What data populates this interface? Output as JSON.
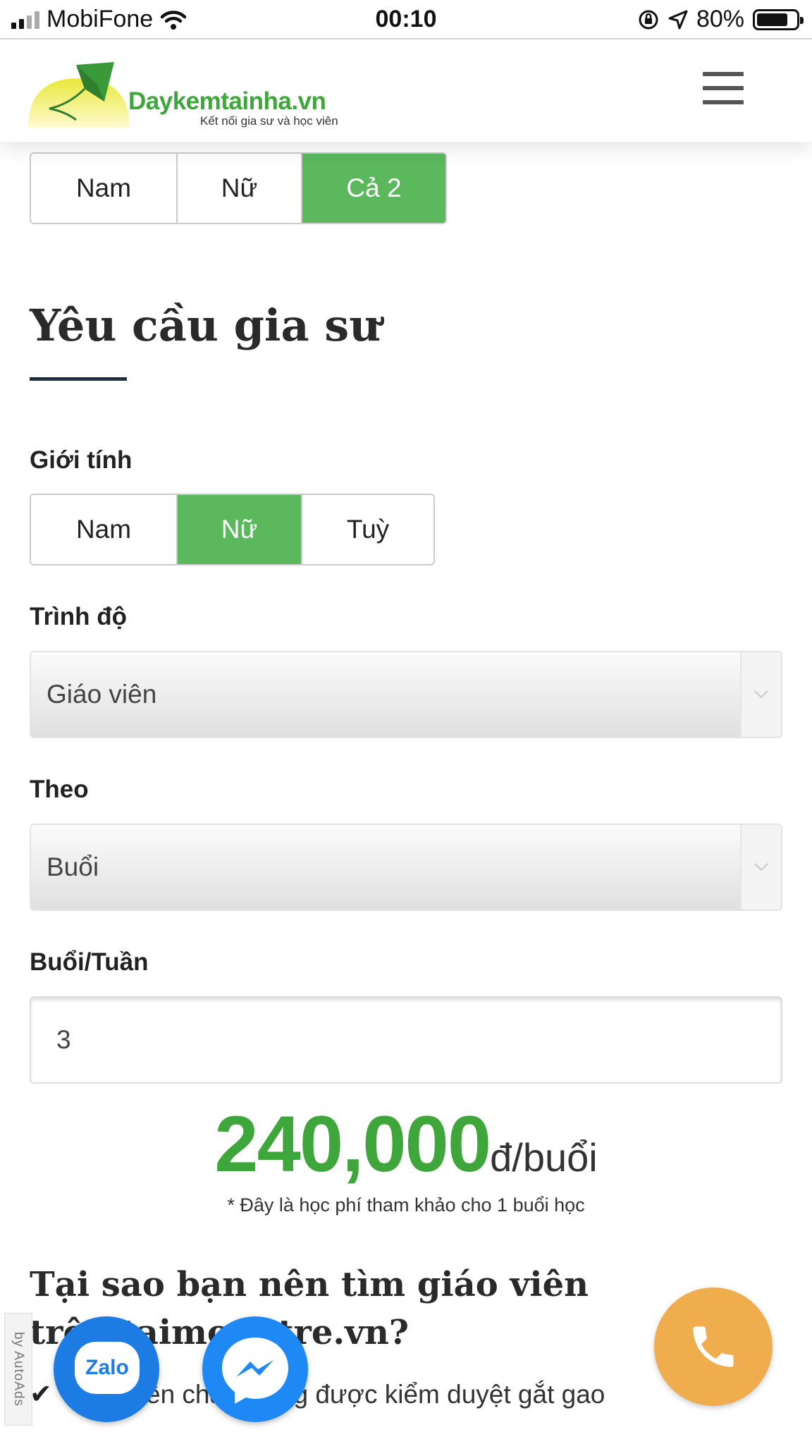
{
  "status_bar": {
    "carrier": "MobiFone",
    "time": "00:10",
    "battery": "80%"
  },
  "header": {
    "logo_name": "Daykemtainha.vn",
    "logo_tagline": "Kết nối gia sư và học viên"
  },
  "top_gender_options": [
    "Nam",
    "Nữ",
    "Cả 2"
  ],
  "section_title": "Yêu cầu gia sư",
  "form": {
    "gender_label": "Giới tính",
    "gender_options": [
      "Nam",
      "Nữ",
      "Tuỳ"
    ],
    "level_label": "Trình độ",
    "level_value": "Giáo viên",
    "by_label": "Theo",
    "by_value": "Buổi",
    "sessions_label": "Buổi/Tuần",
    "sessions_value": "3"
  },
  "price": {
    "amount": "240,000",
    "unit": "đ/buổi",
    "note": "* Đây là học phí tham khảo cho 1 buổi học"
  },
  "why": {
    "title": "Tại sao bạn nên tìm giáo viên trên taimongtre.vn?",
    "bullet": "Giáo viên chất lượng được kiểm duyệt gắt gao"
  },
  "widgets": {
    "autoads": "by AutoAds",
    "zalo": "Zalo"
  }
}
